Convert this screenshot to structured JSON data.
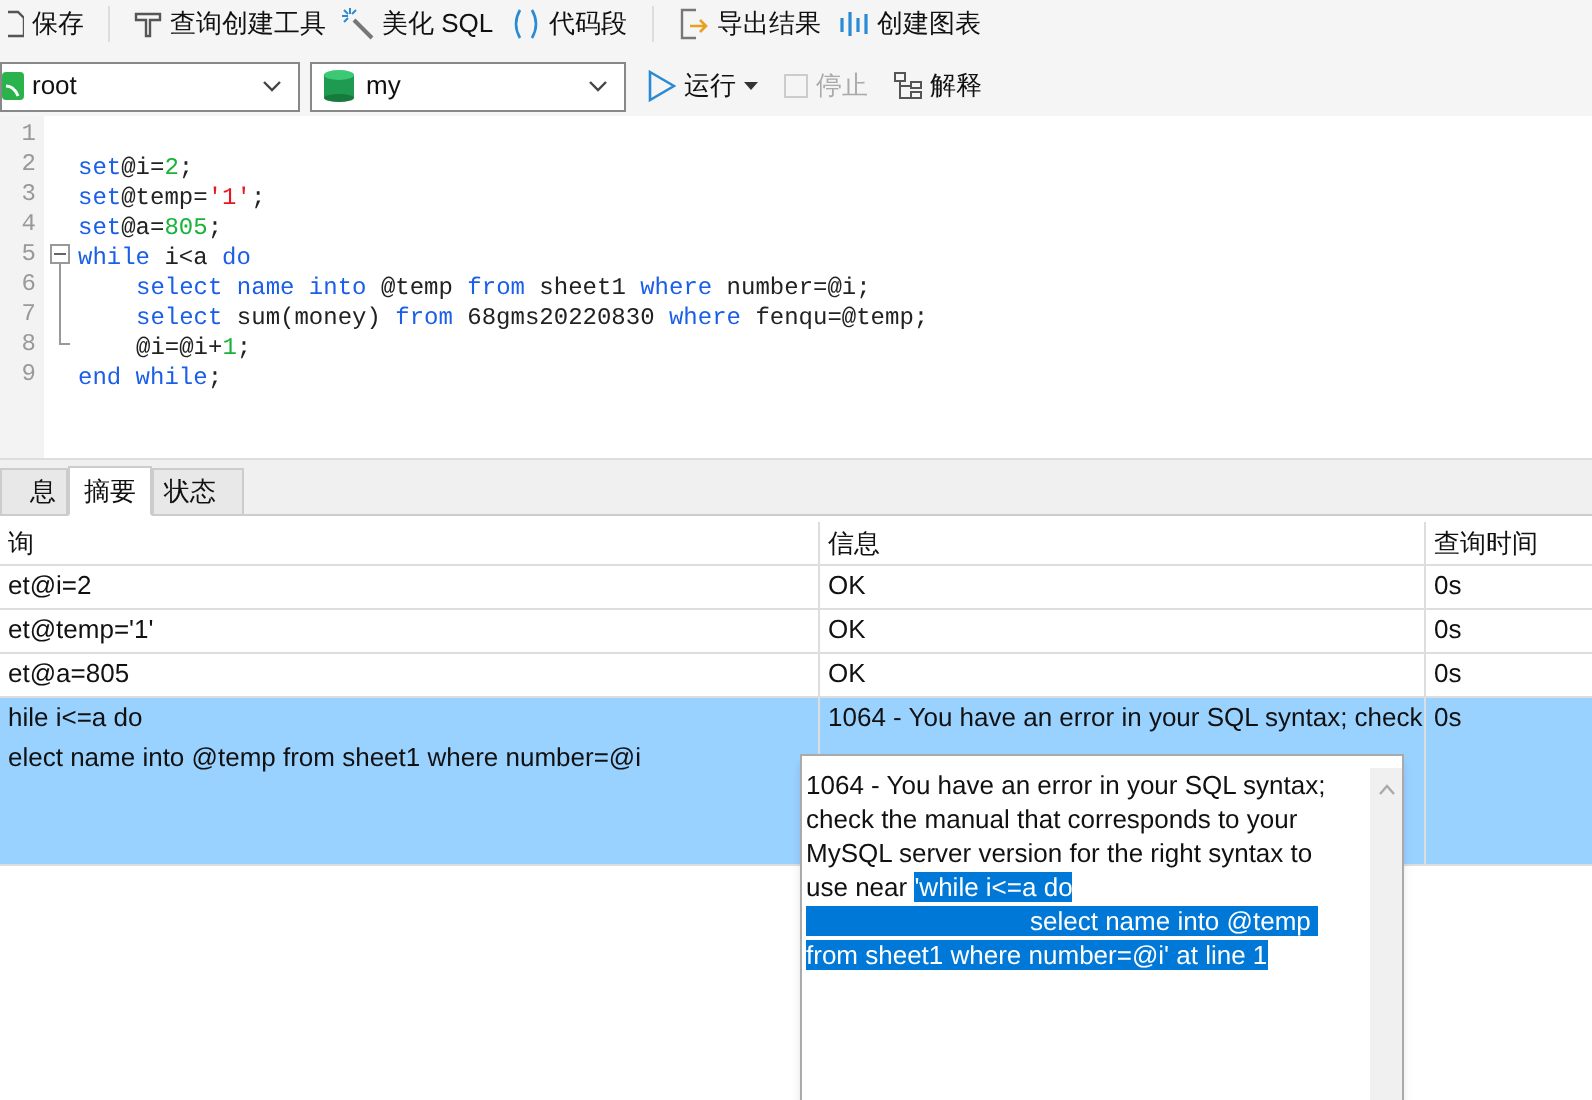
{
  "toolbar": {
    "items": [
      {
        "kind": "save",
        "label": "保存"
      },
      {
        "kind": "builder",
        "label": "查询创建工具"
      },
      {
        "kind": "beautify",
        "label": "美化 SQL"
      },
      {
        "kind": "snippet",
        "label": "代码段"
      },
      {
        "kind": "export",
        "label": "导出结果"
      },
      {
        "kind": "chart",
        "label": "创建图表"
      }
    ]
  },
  "connection": {
    "value": "root"
  },
  "database": {
    "value": "my"
  },
  "actions": [
    {
      "kind": "run",
      "label": "运行",
      "disabled": false
    },
    {
      "kind": "stop",
      "label": "停止",
      "disabled": true
    },
    {
      "kind": "explain",
      "label": "解释",
      "disabled": false
    }
  ],
  "editor": {
    "lines": [
      {
        "number": "1"
      },
      {
        "number": "2",
        "tokens": [
          {
            "kind": "kw",
            "text": "set"
          },
          {
            "kind": "plain",
            "text": "@i="
          },
          {
            "kind": "num",
            "text": "2"
          },
          {
            "kind": "plain",
            "text": ";"
          }
        ]
      },
      {
        "number": "3",
        "tokens": [
          {
            "kind": "kw",
            "text": "set"
          },
          {
            "kind": "plain",
            "text": "@temp="
          },
          {
            "kind": "str",
            "text": "'1'"
          },
          {
            "kind": "plain",
            "text": ";"
          }
        ]
      },
      {
        "number": "4",
        "tokens": [
          {
            "kind": "kw",
            "text": "set"
          },
          {
            "kind": "plain",
            "text": "@a="
          },
          {
            "kind": "num",
            "text": "805"
          },
          {
            "kind": "plain",
            "text": ";"
          }
        ]
      },
      {
        "number": "5",
        "fold": true,
        "tokens": [
          {
            "kind": "kw",
            "text": "while"
          },
          {
            "kind": "plain",
            "text": " i<a "
          },
          {
            "kind": "kw",
            "text": "do"
          }
        ]
      },
      {
        "number": "6",
        "indent": true,
        "tokens": [
          {
            "kind": "kw",
            "text": "select"
          },
          {
            "kind": "kw",
            "text": " name"
          },
          {
            "kind": "kw",
            "text": " into"
          },
          {
            "kind": "plain",
            "text": " @temp "
          },
          {
            "kind": "kw",
            "text": "from"
          },
          {
            "kind": "plain",
            "text": " sheet1 "
          },
          {
            "kind": "kw",
            "text": "where"
          },
          {
            "kind": "plain",
            "text": " number=@i;"
          }
        ]
      },
      {
        "number": "7",
        "indent": true,
        "tokens": [
          {
            "kind": "kw",
            "text": "select"
          },
          {
            "kind": "plain",
            "text": " sum(money) "
          },
          {
            "kind": "kw",
            "text": "from"
          },
          {
            "kind": "plain",
            "text": " 68gms20220830 "
          },
          {
            "kind": "kw",
            "text": "where"
          },
          {
            "kind": "plain",
            "text": " fenqu=@temp;"
          }
        ]
      },
      {
        "number": "8",
        "indent": true,
        "tokens": [
          {
            "kind": "plain",
            "text": "@i=@i+"
          },
          {
            "kind": "num",
            "text": "1"
          },
          {
            "kind": "plain",
            "text": ";"
          }
        ]
      },
      {
        "number": "9",
        "tokens": [
          {
            "kind": "kw",
            "text": "end"
          },
          {
            "kind": "kw",
            "text": " while"
          },
          {
            "kind": "plain",
            "text": ";"
          }
        ]
      }
    ]
  },
  "result_tabs": [
    {
      "label": "息",
      "selected": false
    },
    {
      "label": "摘要",
      "selected": true
    },
    {
      "label": "状态",
      "selected": false
    }
  ],
  "table": {
    "columns": [
      "询",
      "信息",
      "查询时间"
    ],
    "rows": [
      {
        "selected": false,
        "cells": [
          [
            "et@i=2"
          ],
          [
            "OK"
          ],
          [
            "0s"
          ]
        ]
      },
      {
        "selected": false,
        "cells": [
          [
            "et@temp='1'"
          ],
          [
            "OK"
          ],
          [
            "0s"
          ]
        ]
      },
      {
        "selected": false,
        "cells": [
          [
            "et@a=805"
          ],
          [
            "OK"
          ],
          [
            "0s"
          ]
        ]
      },
      {
        "selected": true,
        "cells": [
          [
            "hile i<=a do",
            "elect name into @temp from sheet1 where number=@i"
          ],
          [
            "1064 - You have an error in your SQL syntax; check"
          ],
          [
            "0s"
          ]
        ]
      }
    ]
  },
  "tooltip": {
    "lines": [
      [
        {
          "text": "1064 - You have an error in your SQL syntax;",
          "selected": false
        }
      ],
      [
        {
          "text": "check the manual that corresponds to your",
          "selected": false
        }
      ],
      [
        {
          "text": "MySQL server version for the right syntax to",
          "selected": false
        }
      ],
      [
        {
          "text": "use near ",
          "selected": false
        },
        {
          "text": "'while i<=a do",
          "selected": true
        }
      ],
      [
        {
          "text": "select name into @temp ",
          "selected": true,
          "indent": true
        }
      ],
      [
        {
          "text": "from sheet1 where number=@i' at line 1",
          "selected": true
        }
      ]
    ]
  }
}
